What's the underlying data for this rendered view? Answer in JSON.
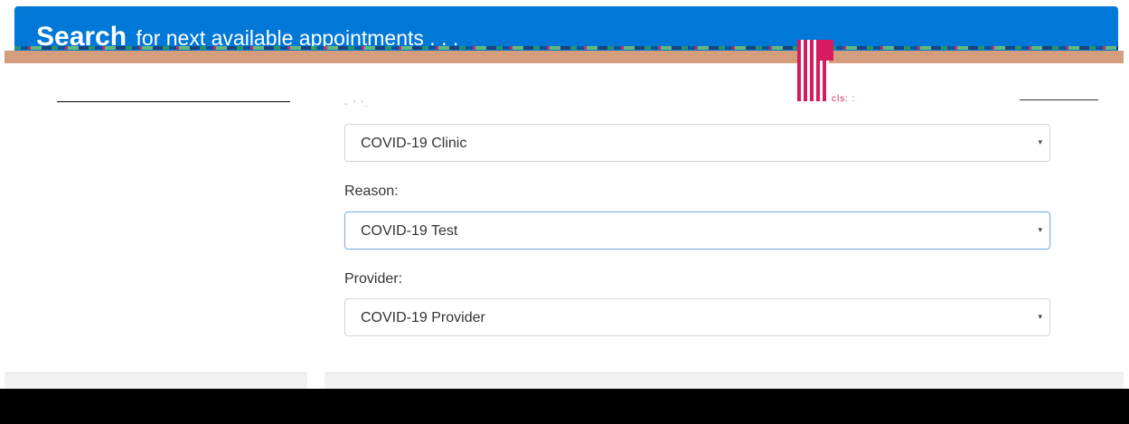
{
  "header": {
    "title_strong": "Search",
    "title_rest": "for next available appointments . . ."
  },
  "misc": {
    "faint_label": "- ' '.",
    "tiny_text": "cls: :"
  },
  "form": {
    "clinic": {
      "value": "COVID-19 Clinic",
      "caret": "▾"
    },
    "reason": {
      "label": "Reason:",
      "value": "COVID-19 Test",
      "caret": "▾"
    },
    "provider": {
      "label": "Provider:",
      "value": "COVID-19 Provider",
      "caret": "▾"
    }
  },
  "colors": {
    "header_bg": "#0078d7",
    "accent": "#d81b60"
  }
}
